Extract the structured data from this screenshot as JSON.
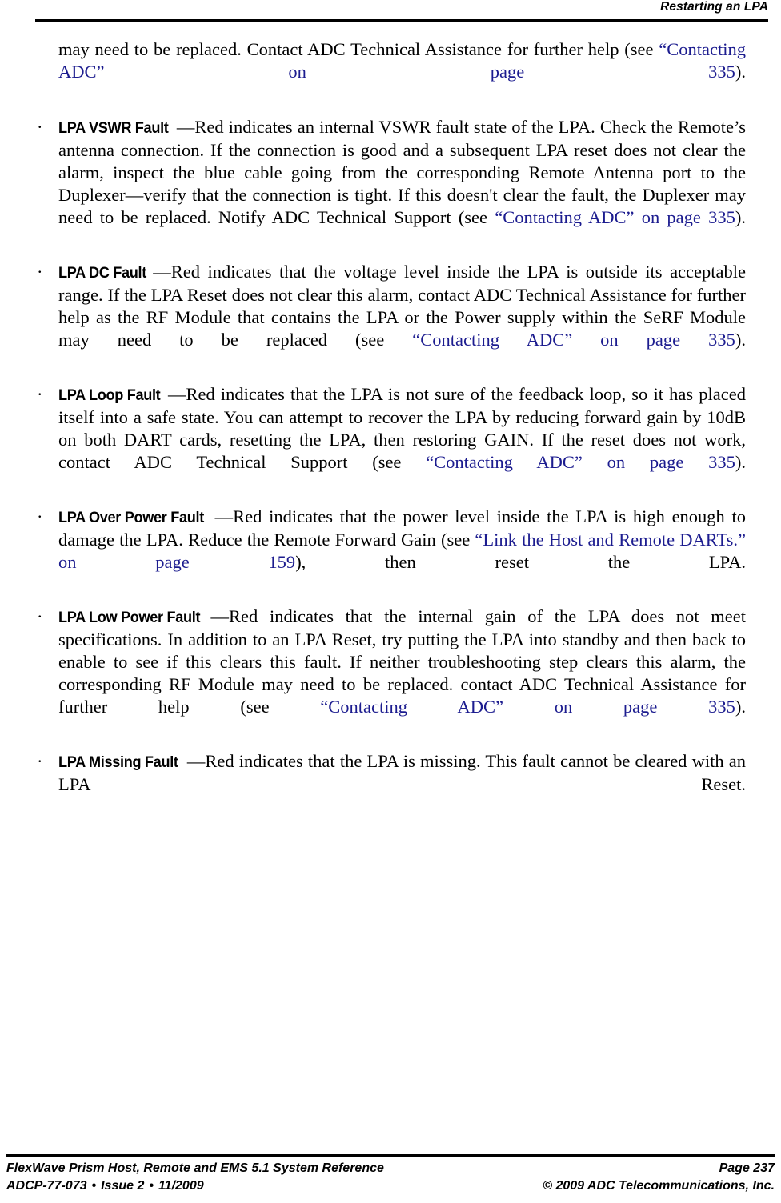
{
  "header": {
    "title": "Restarting an LPA"
  },
  "body": {
    "lead_paragraph": {
      "before_link": "may need to be replaced. Contact ADC Technical Assistance for further help (see ",
      "link": "“Contacting ADC” on page 335",
      "after_link": ")."
    },
    "bullet_marker": "·",
    "bullets": [
      {
        "term": "LPA VSWR Fault",
        "segments": [
          {
            "type": "text",
            "value": "—Red indicates an internal VSWR fault state of the LPA. Check the Remote’s antenna connection. If the connection is good and a subsequent LPA reset does not clear the alarm, inspect the blue cable going from the corresponding Remote Antenna port to the Duplexer—verify that the connection is tight. If this doesn't clear the fault, the Duplexer may need to be replaced. Notify ADC Technical Support (see "
          },
          {
            "type": "link",
            "value": "“Contacting ADC” on page 335"
          },
          {
            "type": "text",
            "value": ")."
          }
        ]
      },
      {
        "term": "LPA DC Fault",
        "segments": [
          {
            "type": "text",
            "value": "—Red indicates that the voltage level inside the LPA is outside its acceptable range. If the LPA Reset does not clear this alarm, contact ADC Technical Assistance for further help as the RF Module that contains the LPA or the Power supply within the SeRF Module may need to be replaced (see "
          },
          {
            "type": "link",
            "value": "“Contacting ADC” on page 335"
          },
          {
            "type": "text",
            "value": ")."
          }
        ]
      },
      {
        "term": "LPA Loop Fault",
        "segments": [
          {
            "type": "text",
            "value": "—Red indicates that the LPA is not sure of the feedback loop, so it has placed itself into a safe state. You can attempt to recover the LPA by reducing forward gain by 10dB on both DART cards, resetting the LPA, then restoring GAIN. If the reset does not work, contact ADC Technical Support (see "
          },
          {
            "type": "link",
            "value": "“Contacting ADC” on page 335"
          },
          {
            "type": "text",
            "value": ")."
          }
        ]
      },
      {
        "term": "LPA Over Power Fault",
        "segments": [
          {
            "type": "text",
            "value": "—Red indicates that the power level inside the LPA is high enough to damage the LPA. Reduce the Remote Forward Gain (see "
          },
          {
            "type": "link",
            "value": "“Link the Host and Remote DARTs.” on page 159"
          },
          {
            "type": "text",
            "value": "), then reset the LPA."
          }
        ]
      },
      {
        "term": "LPA Low Power Fault",
        "segments": [
          {
            "type": "text",
            "value": "—Red indicates that the internal gain of the LPA does not meet specifications. In addition to an LPA Reset, try putting the LPA into standby and then back to enable to see if this clears this fault. If neither troubleshooting step clears this alarm, the corresponding RF Module may need to be replaced. contact ADC Technical Assistance for further help (see "
          },
          {
            "type": "link",
            "value": "“Contacting ADC” on page 335"
          },
          {
            "type": "text",
            "value": ")."
          }
        ]
      },
      {
        "term": "LPA Missing Fault",
        "segments": [
          {
            "type": "text",
            "value": "—Red indicates that the LPA is missing. This fault cannot be cleared with an LPA Reset."
          }
        ]
      }
    ]
  },
  "footer": {
    "line1_left": "FlexWave Prism Host, Remote and EMS 5.1 System Reference",
    "line1_right": "Page 237",
    "line2_left_doc": "ADCP-77-073",
    "line2_left_issue": "Issue 2",
    "line2_left_date": "11/2009",
    "line2_separator": "•",
    "line2_right": "© 2009 ADC Telecommunications, Inc."
  },
  "colors": {
    "link": "#1c1c8f",
    "text": "#000000",
    "rule": "#000000"
  }
}
